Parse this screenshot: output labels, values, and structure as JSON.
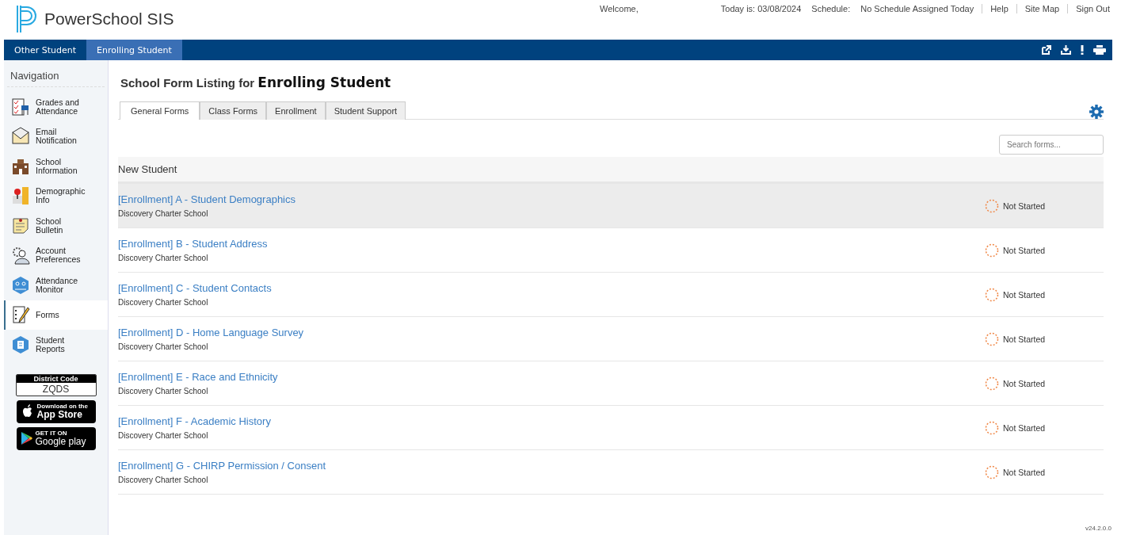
{
  "header": {
    "product": "PowerSchool SIS",
    "welcome": "Welcome,",
    "today": "Today is: 03/08/2024",
    "schedule_label": "Schedule:",
    "schedule": "No Schedule Assigned Today",
    "links": [
      "Help",
      "Site Map",
      "Sign Out"
    ]
  },
  "student_tabs": [
    {
      "label": "Other Student",
      "selected": false
    },
    {
      "label": "Enrolling Student",
      "selected": true
    }
  ],
  "sidebar": {
    "title": "Navigation",
    "items": [
      {
        "label": "Grades and Attendance",
        "selected": false
      },
      {
        "label": "Email Notification",
        "selected": false
      },
      {
        "label": "School Information",
        "selected": false
      },
      {
        "label": "Demographic Info",
        "selected": false
      },
      {
        "label": "School Bulletin",
        "selected": false
      },
      {
        "label": "Account Preferences",
        "selected": false
      },
      {
        "label": "Attendance Monitor",
        "selected": false
      },
      {
        "label": "Forms",
        "selected": true
      },
      {
        "label": "Student Reports",
        "selected": false
      }
    ],
    "district_code_label": "District Code",
    "district_code": "ZQDS",
    "app_store": [
      "Download on the",
      "App Store"
    ],
    "google_play": [
      "GET IT ON",
      "Google play"
    ]
  },
  "page": {
    "title_prefix": "School Form Listing for",
    "title_student": "Enrolling Student"
  },
  "tabs": [
    {
      "label": "General Forms",
      "selected": true
    },
    {
      "label": "Class Forms",
      "selected": false
    },
    {
      "label": "Enrollment",
      "selected": false
    },
    {
      "label": "Student Support",
      "selected": false
    }
  ],
  "search": {
    "placeholder": "Search forms..."
  },
  "group": "New Student",
  "forms": [
    {
      "title": "[Enrollment] A - Student Demographics",
      "school": "Discovery Charter School",
      "status": "Not Started",
      "kind": "not_started",
      "selected": true
    },
    {
      "title": "[Enrollment] B - Student Address",
      "school": "Discovery Charter School",
      "status": "Not Started",
      "kind": "not_started",
      "selected": false
    },
    {
      "title": "[Enrollment] C - Student Contacts",
      "school": "Discovery Charter School",
      "status": "Not Started",
      "kind": "not_started",
      "selected": false
    },
    {
      "title": "[Enrollment] D - Home Language Survey",
      "school": "Discovery Charter School",
      "status": "Not Started",
      "kind": "not_started",
      "selected": false
    },
    {
      "title": "[Enrollment] E - Race and Ethnicity",
      "school": "Discovery Charter School",
      "status": "Not Started",
      "kind": "not_started",
      "selected": false
    },
    {
      "title": "[Enrollment] F - Academic History",
      "school": "Discovery Charter School",
      "status": "Not Started",
      "kind": "not_started",
      "selected": false
    },
    {
      "title": "[Enrollment] G - CHIRP Permission / Consent",
      "school": "Discovery Charter School",
      "status": "Not Started",
      "kind": "not_started",
      "selected": false
    }
  ],
  "version": "v24.2.0.0"
}
